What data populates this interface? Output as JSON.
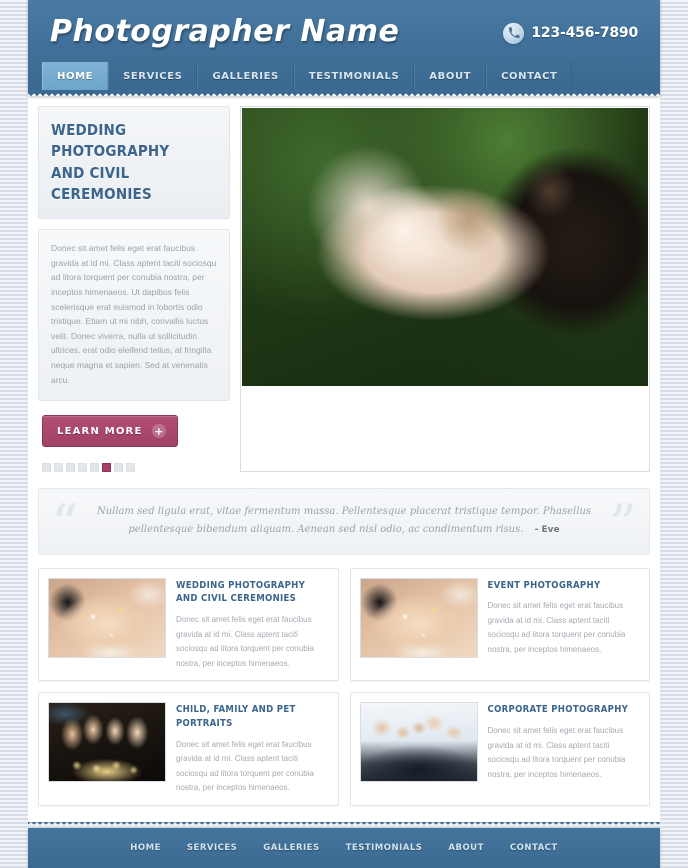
{
  "header": {
    "logo": "Photographer Name",
    "phone": "123-456-7890",
    "phone_icon": "phone-icon",
    "nav": [
      {
        "label": "HOME",
        "active": true
      },
      {
        "label": "SERVICES",
        "active": false
      },
      {
        "label": "GALLERIES",
        "active": false
      },
      {
        "label": "TESTIMONIALS",
        "active": false
      },
      {
        "label": "ABOUT",
        "active": false
      },
      {
        "label": "CONTACT",
        "active": false
      }
    ]
  },
  "hero": {
    "title_line1": "WEDDING PHOTOGRAPHY",
    "title_line2": "AND CIVIL CEREMONIES",
    "body": "Donec sit amet felis eget erat faucibus gravida at id mi. Class aptent taciti sociosqu ad litora torquent per conubia nostra, per inceptos himenaeos. Ut dapibus felis scelerisque erat euismod in lobortis odio tristique. Etiam ut mi nibh, convallis luctus velit. Donec viverra, nulla ut sollicitudin ultrices, erat odio eleifend tellus, at fringilla neque magna et sapien. Sed at venenatis arcu.",
    "button_label": "LEARN MORE",
    "button_icon": "plus-icon",
    "image_alt": "bride and groom holding wooden box outdoors",
    "slider": {
      "count": 8,
      "active_index": 5
    }
  },
  "quote": {
    "open_quote": "“",
    "close_quote": "”",
    "text": "Nullam sed ligula erat, vitae fermentum massa. Pellentesque placerat tristique tempor. Phasellus pellentesque bibendum aliquam. Aenean sed nisl odio, ac condimentum risus.",
    "author": "- Eve"
  },
  "services": [
    {
      "title": "WEDDING PHOTOGRAPHY AND CIVIL CEREMONIES",
      "text": "Donec sit amet felis eget erat faucibus gravida at id mi. Class aptent taciti sociosqu ad litora torquent per conubia nostra, per inceptos himenaeos.",
      "image_alt": "hands with wedding rings",
      "thumb_class": "ph-rings"
    },
    {
      "title": "EVENT PHOTOGRAPHY",
      "text": "Donec sit amet felis eget erat faucibus gravida at id mi. Class aptent taciti sociosqu ad litora torquent per conubia nostra, per inceptos himenaeos.",
      "image_alt": "hands with wedding rings",
      "thumb_class": "ph-rings"
    },
    {
      "title": "CHILD, FAMILY AND PET PORTRAITS",
      "text": "Donec sit amet felis eget erat faucibus gravida at id mi. Class aptent taciti sociosqu ad litora torquent per conubia nostra, per inceptos himenaeos.",
      "image_alt": "group of friends toasting with champagne",
      "thumb_class": "ph-party"
    },
    {
      "title": "CORPORATE PHOTOGRAPHY",
      "text": "Donec sit amet felis eget erat faucibus gravida at id mi. Class aptent taciti sociosqu ad litora torquent per conubia nostra, per inceptos himenaeos.",
      "image_alt": "business team in suits",
      "thumb_class": "ph-corp"
    }
  ],
  "footer": {
    "nav": [
      "HOME",
      "SERVICES",
      "GALLERIES",
      "TESTIMONIALS",
      "ABOUT",
      "CONTACT"
    ]
  },
  "colors": {
    "header_blue": "#3e6e96",
    "nav_active_blue": "#7fb2d4",
    "accent_pink": "#a8416a",
    "heading_blue": "#3c658c",
    "page_bg": "#dfe4ec",
    "body_text": "#9aa3ab"
  }
}
